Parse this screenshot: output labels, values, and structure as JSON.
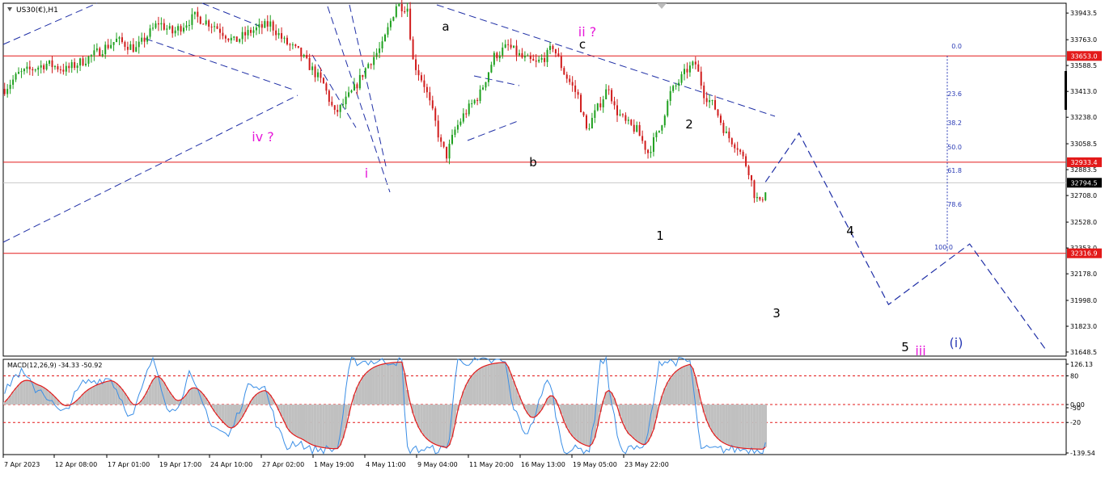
{
  "chart_data": {
    "type": "candlestick",
    "title": "US30(€),H1",
    "colors": {
      "background": "#ffffff",
      "bull": "#1fa01f",
      "bear": "#d01c1c",
      "hline": "#e31a1a",
      "price_tag_bg": "#e31a1a",
      "current_tag_bg": "#000000",
      "trend_dash": "#1f2fa6",
      "magenta": "#e619d9",
      "fib": "#2a3bb5",
      "macd_hist": "#c0c0c0",
      "macd_signal": "#e31a1a",
      "macd_line": "#3a8ee6",
      "grid_level": "#e31a1a"
    },
    "y_axis": {
      "range": [
        31621,
        34010
      ],
      "ticks": [
        "33943.5",
        "33763.0",
        "33588.5",
        "33413.0",
        "33238.0",
        "33058.5",
        "32883.5",
        "32708.0",
        "32528.0",
        "32353.0",
        "32178.0",
        "31998.0",
        "31823.0",
        "31648.5"
      ]
    },
    "x_axis": {
      "ticks": [
        "7 Apr 2023",
        "12 Apr 08:00",
        "17 Apr 01:00",
        "19 Apr 17:00",
        "24 Apr 10:00",
        "27 Apr 02:00",
        "1 May 19:00",
        "4 May 11:00",
        "9 May 04:00",
        "11 May 20:00",
        "16 May 13:00",
        "19 May 05:00",
        "23 May 22:00"
      ]
    },
    "h_lines": [
      {
        "value": 33653.0,
        "label": "33653.0"
      },
      {
        "value": 32933.4,
        "label": "32933.4"
      },
      {
        "value": 32316.9,
        "label": "32316.9"
      }
    ],
    "current_price": {
      "value": 32794.5,
      "label": "32794.5"
    },
    "series_path": [
      [
        0,
        33430
      ],
      [
        5,
        33530
      ],
      [
        15,
        33600
      ],
      [
        22,
        33560
      ],
      [
        30,
        33640
      ],
      [
        40,
        33760
      ],
      [
        47,
        33700
      ],
      [
        55,
        33880
      ],
      [
        60,
        33810
      ],
      [
        68,
        33920
      ],
      [
        75,
        33860
      ],
      [
        82,
        33750
      ],
      [
        88,
        33820
      ],
      [
        95,
        33870
      ],
      [
        100,
        33750
      ],
      [
        105,
        33680
      ],
      [
        110,
        33560
      ],
      [
        114,
        33460
      ],
      [
        118,
        33260
      ],
      [
        120,
        33300
      ],
      [
        125,
        33430
      ],
      [
        130,
        33600
      ],
      [
        135,
        33720
      ],
      [
        140,
        34000
      ],
      [
        144,
        33980
      ],
      [
        146,
        33620
      ],
      [
        150,
        33460
      ],
      [
        154,
        33200
      ],
      [
        156,
        33050
      ],
      [
        158,
        32980
      ],
      [
        161,
        33150
      ],
      [
        164,
        33250
      ],
      [
        170,
        33400
      ],
      [
        175,
        33650
      ],
      [
        180,
        33720
      ],
      [
        185,
        33640
      ],
      [
        190,
        33600
      ],
      [
        194,
        33660
      ],
      [
        196,
        33720
      ],
      [
        200,
        33540
      ],
      [
        205,
        33380
      ],
      [
        208,
        33150
      ],
      [
        212,
        33300
      ],
      [
        216,
        33450
      ],
      [
        218,
        33300
      ],
      [
        222,
        33200
      ],
      [
        226,
        33150
      ],
      [
        230,
        33000
      ],
      [
        234,
        33150
      ],
      [
        238,
        33400
      ],
      [
        240,
        33450
      ],
      [
        244,
        33560
      ],
      [
        247,
        33600
      ],
      [
        250,
        33400
      ],
      [
        254,
        33300
      ],
      [
        258,
        33120
      ],
      [
        262,
        33040
      ],
      [
        266,
        32880
      ],
      [
        268,
        32720
      ],
      [
        270,
        32650
      ],
      [
        272,
        32750
      ]
    ],
    "wave_labels": [
      {
        "label": "iv ?",
        "color": "magenta"
      },
      {
        "label": "i",
        "color": "magenta"
      },
      {
        "label": "a",
        "color": "black"
      },
      {
        "label": "b",
        "color": "black"
      },
      {
        "label": "ii ?",
        "color": "magenta"
      },
      {
        "label": "c",
        "color": "black"
      },
      {
        "label": "1",
        "color": "black"
      },
      {
        "label": "2",
        "color": "black"
      },
      {
        "label": "3",
        "color": "black"
      },
      {
        "label": "4",
        "color": "black"
      },
      {
        "label": "5",
        "color": "black"
      },
      {
        "label": "iii",
        "color": "magenta"
      },
      {
        "label": "(i)",
        "color": "blue"
      }
    ],
    "projection": [
      {
        "bar": 272,
        "value": 32800
      },
      {
        "bar": 284,
        "value": 33130
      },
      {
        "bar": 316,
        "value": 31970
      },
      {
        "bar": 345,
        "value": 32380
      },
      {
        "bar": 372,
        "value": 31670
      }
    ],
    "fib_levels": [
      "0.0",
      "23.6",
      "38.2",
      "50.0",
      "61.8",
      "78.6",
      "100.0"
    ],
    "macd": {
      "label": "MACD(12,26,9) -34.33 -50.92",
      "ticks": [
        "126.13",
        "80",
        "0.00",
        "-50",
        "-20",
        "-139.54"
      ],
      "levels": [
        80,
        0,
        -50
      ],
      "range": [
        -139.54,
        126.13
      ]
    }
  }
}
